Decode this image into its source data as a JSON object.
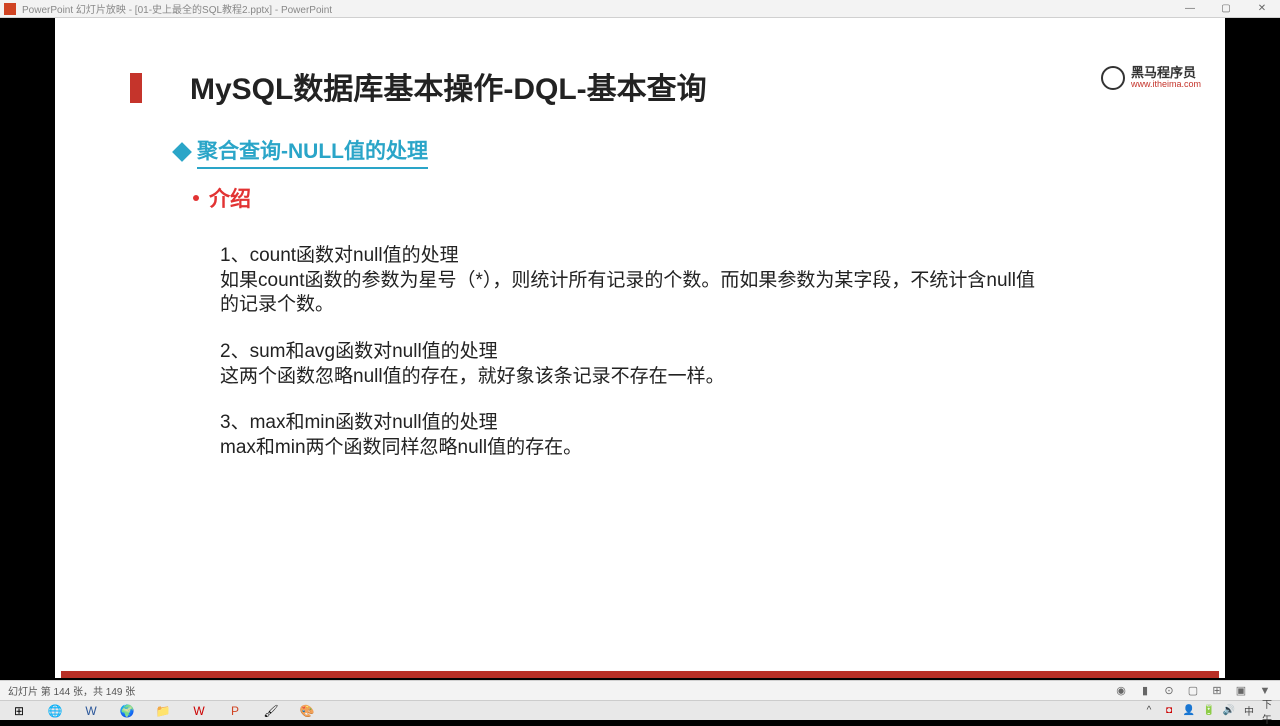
{
  "window": {
    "title": "PowerPoint 幻灯片放映 - [01-史上最全的SQL教程2.pptx] - PowerPoint"
  },
  "slide": {
    "title": "MySQL数据库基本操作-DQL-基本查询",
    "subtitle": "聚合查询-NULL值的处理",
    "intro_label": "介绍",
    "p1a": "1、count函数对null值的处理",
    "p1b": "如果count函数的参数为星号（*），则统计所有记录的个数。而如果参数为某字段，不统计含null值的记录个数。",
    "p2a": "2、sum和avg函数对null值的处理",
    "p2b": "这两个函数忽略null值的存在，就好象该条记录不存在一样。",
    "p3a": "3、max和min函数对null值的处理",
    "p3b": " max和min两个函数同样忽略null值的存在。"
  },
  "brand": {
    "cn": "黑马程序员",
    "en": "www.itheima.com"
  },
  "status": {
    "slidecount": "幻灯片 第 144 张，共 149 张"
  },
  "tray": {
    "time": "下午"
  }
}
